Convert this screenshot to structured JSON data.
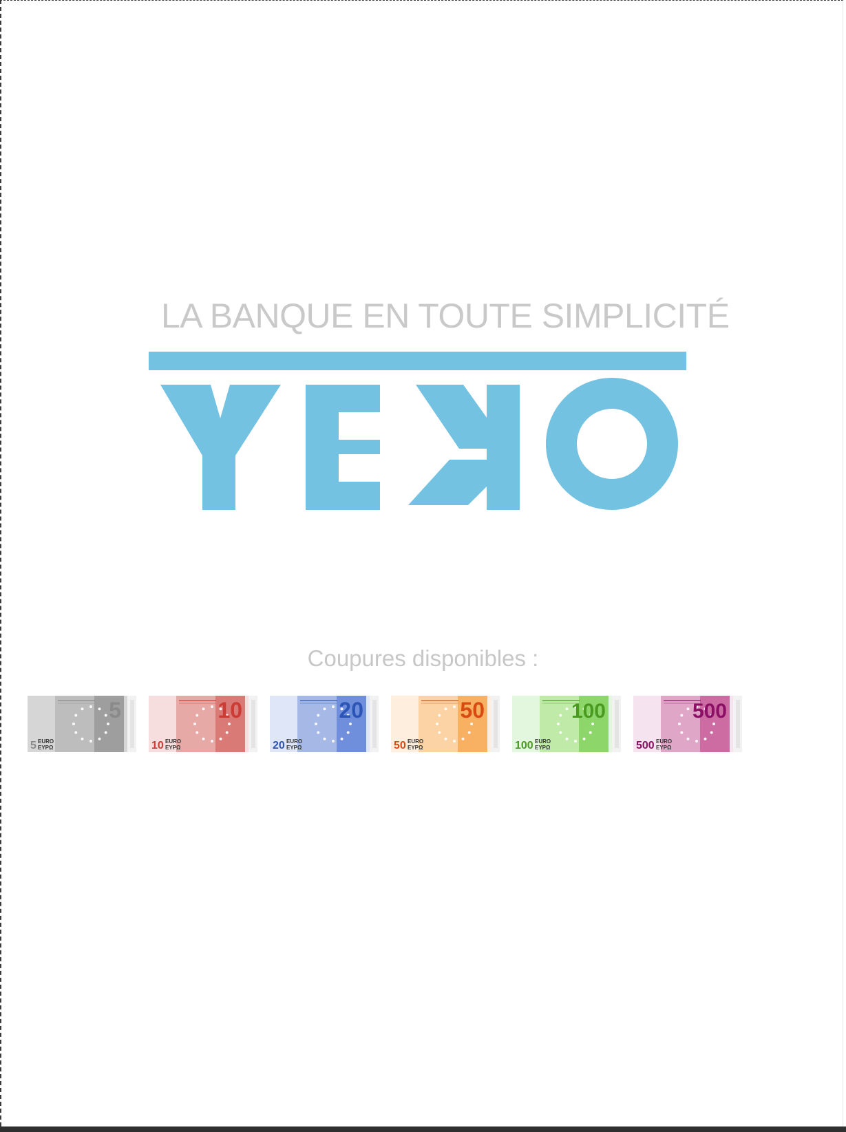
{
  "tagline": "LA BANQUE EN TOUTE SIMPLICITÉ",
  "logo": {
    "text": "YEKO",
    "color": "#74c2e1"
  },
  "caption": "Coupures disponibles :",
  "notes": [
    {
      "value": "5",
      "currency": "EURO",
      "greek": "ΕΥΡΩ",
      "color": "#8a8a8a",
      "light": "#d6d6d6",
      "mid": "#bdbdbd",
      "dark": "#9e9e9e"
    },
    {
      "value": "10",
      "currency": "EURO",
      "greek": "ΕΥΡΩ",
      "color": "#cc3b34",
      "light": "#f6dede",
      "mid": "#e6a9a6",
      "dark": "#d97a76"
    },
    {
      "value": "20",
      "currency": "EURO",
      "greek": "ΕΥΡΩ",
      "color": "#2d55b5",
      "light": "#dfe6f7",
      "mid": "#a5b8e6",
      "dark": "#6f8fdc"
    },
    {
      "value": "50",
      "currency": "EURO",
      "greek": "ΕΥΡΩ",
      "color": "#d84a12",
      "light": "#fdeedd",
      "mid": "#fcd3a4",
      "dark": "#f8b062"
    },
    {
      "value": "100",
      "currency": "EURO",
      "greek": "ΕΥΡΩ",
      "color": "#4a9a22",
      "light": "#e3f6de",
      "mid": "#bfeaa8",
      "dark": "#8dd66a"
    },
    {
      "value": "500",
      "currency": "EURO",
      "greek": "ΕΥΡΩ",
      "color": "#8a1065",
      "light": "#f5e3ef",
      "mid": "#dfa6c7",
      "dark": "#cc6ca3"
    }
  ]
}
